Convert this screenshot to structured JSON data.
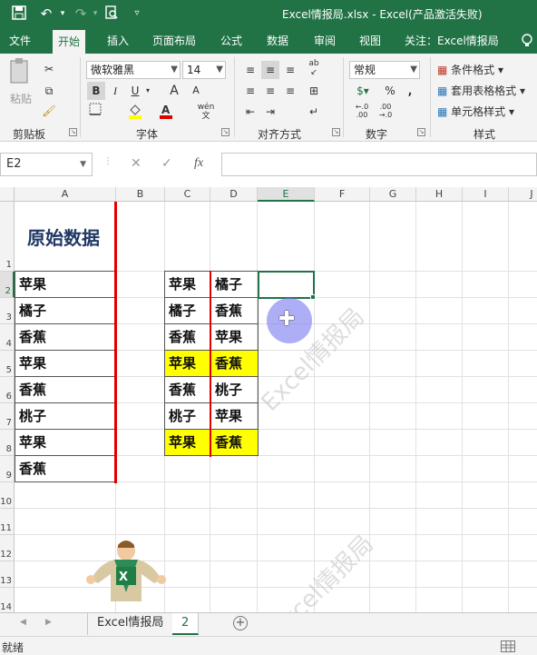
{
  "titlebar": {
    "title": "Excel情报局.xlsx  -  Excel(产品激活失败)",
    "save_icon": "save-icon",
    "undo_icon": "undo-icon",
    "redo_icon": "redo-icon",
    "preview_icon": "print-preview-icon",
    "customize_icon": "customize-qat-icon"
  },
  "tabs": [
    {
      "label": "文件"
    },
    {
      "label": "开始"
    },
    {
      "label": "插入"
    },
    {
      "label": "页面布局"
    },
    {
      "label": "公式"
    },
    {
      "label": "数据"
    },
    {
      "label": "审阅"
    },
    {
      "label": "视图"
    },
    {
      "label": "关注：Excel情报局"
    }
  ],
  "ribbon": {
    "clipboard": {
      "paste_label": "粘贴",
      "group_label": "剪贴板"
    },
    "font": {
      "font_name": "微软雅黑",
      "font_size": "14",
      "group_label": "字体",
      "bold": "B",
      "italic": "I",
      "underline": "U",
      "grow": "A",
      "shrink": "A",
      "phonetic": "wén"
    },
    "alignment": {
      "group_label": "对齐方式"
    },
    "number": {
      "format": "常规",
      "group_label": "数字",
      "percent": "%",
      "comma": ","
    },
    "styles": {
      "conditional": "条件格式",
      "table": "套用表格格式",
      "cell_styles": "单元格样式",
      "group_label": "样式"
    }
  },
  "formulabar": {
    "namebox": "E2",
    "cancel": "✕",
    "enter": "✓",
    "fx": "fx",
    "value": ""
  },
  "columns": [
    "A",
    "B",
    "C",
    "D",
    "E",
    "F",
    "G",
    "H",
    "I",
    "J"
  ],
  "rows": [
    "1",
    "2",
    "3",
    "4",
    "5",
    "6",
    "7",
    "8",
    "9",
    "10",
    "11",
    "12",
    "13",
    "14"
  ],
  "sheet": {
    "title_cell": "原始数据",
    "col_a": [
      "苹果",
      "橘子",
      "香蕉",
      "苹果",
      "香蕉",
      "桃子",
      "苹果",
      "香蕉"
    ],
    "col_c": [
      "苹果",
      "橘子",
      "香蕉",
      "苹果",
      "香蕉",
      "桃子",
      "苹果"
    ],
    "col_d": [
      "橘子",
      "香蕉",
      "苹果",
      "香蕉",
      "桃子",
      "苹果",
      "香蕉"
    ],
    "highlight_rows": [
      5,
      8
    ],
    "highlight_color": "#ffff00",
    "divider_color": "#e00000",
    "selected_cell": "E2",
    "watermark": "Excel情报局"
  },
  "sheet_tabs": [
    {
      "label": "Excel情报局"
    },
    {
      "label": "2"
    }
  ],
  "status": {
    "text": "就绪"
  },
  "colors": {
    "accent": "#217346"
  }
}
